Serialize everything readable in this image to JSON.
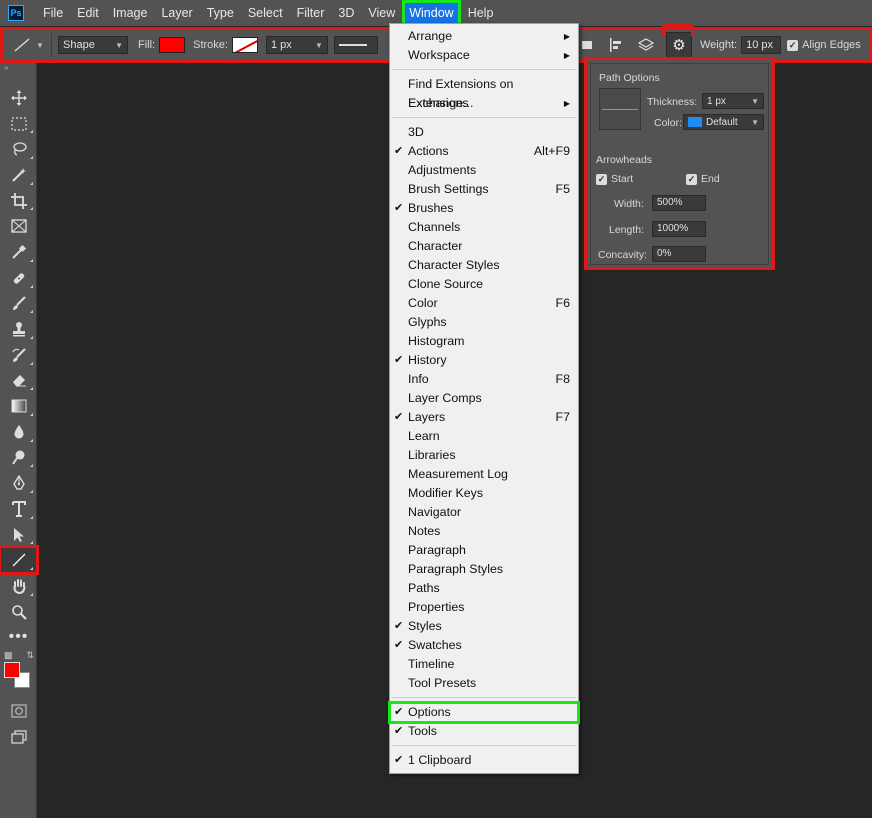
{
  "app": {
    "logo_text": "Ps"
  },
  "menubar": {
    "items": [
      "File",
      "Edit",
      "Image",
      "Layer",
      "Type",
      "Select",
      "Filter",
      "3D",
      "View",
      "Window",
      "Help"
    ]
  },
  "options_bar": {
    "mode": "Shape",
    "fill_label": "Fill:",
    "fill_color": "#ff0000",
    "stroke_label": "Stroke:",
    "stroke_width": "1 px",
    "weight_label": "Weight:",
    "weight_value": "10 px",
    "align_edges_label": "Align Edges",
    "align_edges_checked": true
  },
  "window_menu": {
    "items": [
      {
        "label": "Arrange",
        "submenu": true
      },
      {
        "label": "Workspace",
        "submenu": true
      },
      {
        "separator": true
      },
      {
        "label": "Find Extensions on Exchange..."
      },
      {
        "label": "Extensions",
        "submenu": true
      },
      {
        "separator": true
      },
      {
        "label": "3D"
      },
      {
        "label": "Actions",
        "checked": true,
        "shortcut": "Alt+F9"
      },
      {
        "label": "Adjustments"
      },
      {
        "label": "Brush Settings",
        "shortcut": "F5"
      },
      {
        "label": "Brushes",
        "checked": true
      },
      {
        "label": "Channels"
      },
      {
        "label": "Character"
      },
      {
        "label": "Character Styles"
      },
      {
        "label": "Clone Source"
      },
      {
        "label": "Color",
        "shortcut": "F6"
      },
      {
        "label": "Glyphs"
      },
      {
        "label": "Histogram"
      },
      {
        "label": "History",
        "checked": true
      },
      {
        "label": "Info",
        "shortcut": "F8"
      },
      {
        "label": "Layer Comps"
      },
      {
        "label": "Layers",
        "checked": true,
        "shortcut": "F7"
      },
      {
        "label": "Learn"
      },
      {
        "label": "Libraries"
      },
      {
        "label": "Measurement Log"
      },
      {
        "label": "Modifier Keys"
      },
      {
        "label": "Navigator"
      },
      {
        "label": "Notes"
      },
      {
        "label": "Paragraph"
      },
      {
        "label": "Paragraph Styles"
      },
      {
        "label": "Paths"
      },
      {
        "label": "Properties"
      },
      {
        "label": "Styles",
        "checked": true
      },
      {
        "label": "Swatches",
        "checked": true
      },
      {
        "label": "Timeline"
      },
      {
        "label": "Tool Presets"
      },
      {
        "separator": true
      },
      {
        "label": "Options",
        "checked": true,
        "highlight": true
      },
      {
        "label": "Tools",
        "checked": true
      },
      {
        "separator": true
      },
      {
        "label": "1 Clipboard",
        "checked": true
      }
    ]
  },
  "path_options": {
    "title": "Path Options",
    "thickness_label": "Thickness:",
    "thickness_value": "1 px",
    "color_label": "Color:",
    "color_value": "Default",
    "arrowheads_label": "Arrowheads",
    "start_label": "Start",
    "start_checked": true,
    "end_label": "End",
    "end_checked": true,
    "width_label": "Width:",
    "width_value": "500%",
    "length_label": "Length:",
    "length_value": "1000%",
    "concavity_label": "Concavity:",
    "concavity_value": "0%"
  },
  "toolbar": {
    "tools": [
      "move-tool",
      "marquee-tool",
      "lasso-tool",
      "magic-wand-tool",
      "crop-tool",
      "frame-tool",
      "eyedropper-tool",
      "healing-brush-tool",
      "brush-tool",
      "clone-stamp-tool",
      "history-brush-tool",
      "eraser-tool",
      "gradient-tool",
      "blur-tool",
      "dodge-tool",
      "pen-tool",
      "type-tool",
      "path-selection-tool",
      "line-tool",
      "hand-tool",
      "zoom-tool",
      "edit-toolbar"
    ],
    "selected": "line-tool",
    "foreground_color": "#ff0000",
    "background_color": "#ffffff"
  }
}
